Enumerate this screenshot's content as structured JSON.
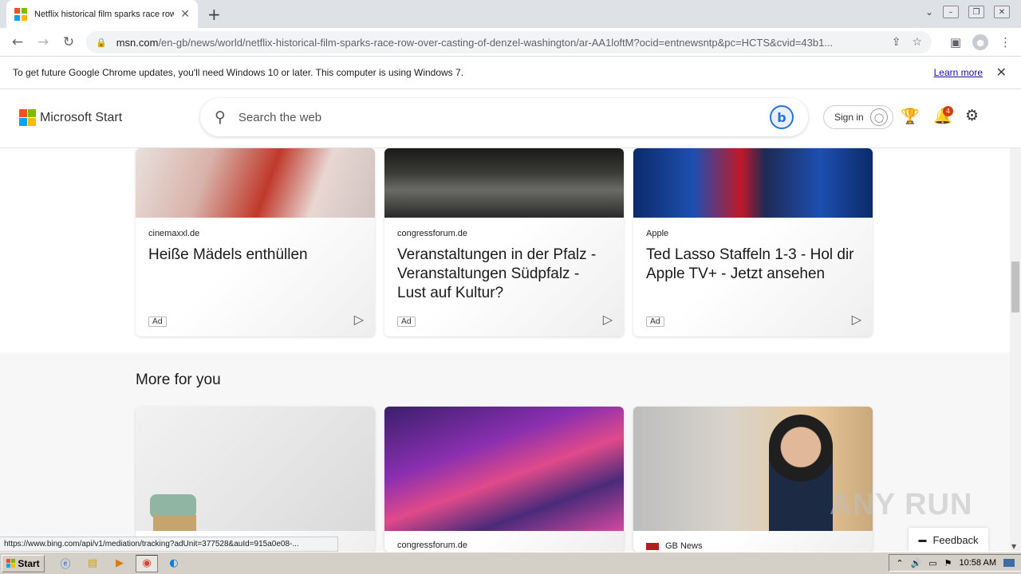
{
  "browser": {
    "tab_title": "Netflix historical film sparks race row over casting of Denzel Washington",
    "tab_close": "✕",
    "new_tab": "+",
    "url_host": "msn.com",
    "url_path": "/en-gb/news/world/netflix-historical-film-sparks-race-row-over-casting-of-denzel-washington/ar-AA1loftM?ocid=entnewsntp&pc=HCTS&cvid=43b1...",
    "infobar_text": "To get future Google Chrome updates, you'll need Windows 10 or later. This computer is using Windows 7.",
    "infobar_link": "Learn more",
    "status_url": "https://www.bing.com/api/v1/mediation/tracking?adUnit=377528&auId=915a0e08-..."
  },
  "msn": {
    "brand": "Microsoft Start",
    "search_placeholder": "Search the web",
    "signin_label": "Sign in",
    "notification_count": "4"
  },
  "ad_cards": [
    {
      "source": "cinemaxxl.de",
      "headline": "Heiße Mädels enthüllen",
      "tag": "Ad"
    },
    {
      "source": "congressforum.de",
      "headline": "Veranstaltungen in der Pfalz - Veranstaltungen Südpfalz - Lust auf Kultur?",
      "tag": "Ad"
    },
    {
      "source": "Apple",
      "headline": "Ted Lasso Staffeln 1-3 - Hol dir Apple TV+ - Jetzt ansehen",
      "tag": "Ad"
    }
  ],
  "more_for_you": {
    "title": "More for you",
    "cards": [
      {
        "source": ""
      },
      {
        "source": "congressforum.de"
      },
      {
        "source": "GB News"
      }
    ]
  },
  "feedback_label": "Feedback",
  "watermark": "ANY RUN",
  "taskbar": {
    "start_label": "Start",
    "time": "10:58 AM"
  },
  "colors": {
    "ms_red": "#f25022",
    "ms_green": "#7fba00",
    "ms_blue": "#00a4ef",
    "ms_yellow": "#ffb900",
    "link": "#1a0dab",
    "badge": "#d83b01"
  }
}
